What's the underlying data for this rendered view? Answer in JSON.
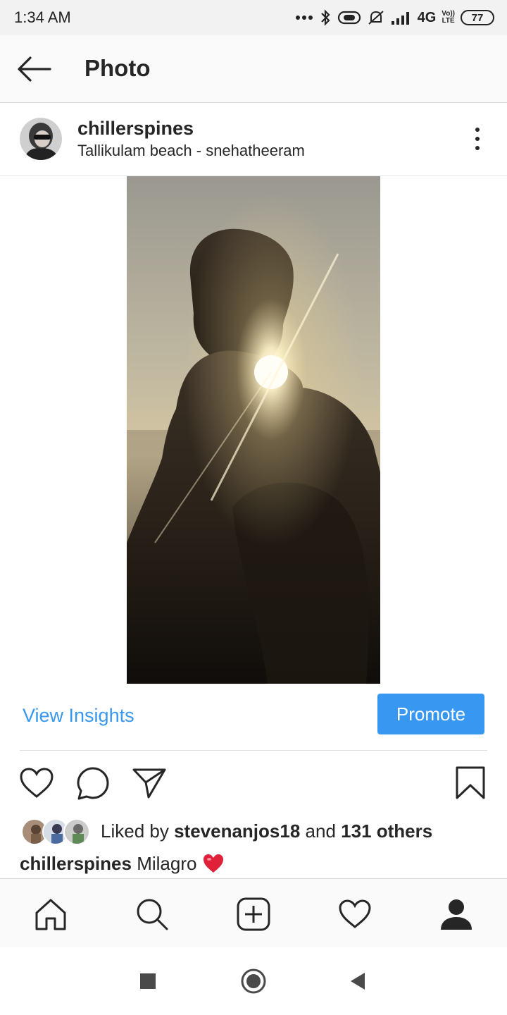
{
  "status_bar": {
    "time": "1:34 AM",
    "network": "4G",
    "volte_top": "Vo))",
    "volte_bottom": "LTE",
    "battery": "77",
    "icons": [
      "more-dots-icon",
      "bluetooth-icon",
      "toggle-icon",
      "mute-icon",
      "signal-icon"
    ]
  },
  "app_bar": {
    "title": "Photo",
    "back_icon": "back-arrow-icon"
  },
  "post": {
    "username": "chillerspines",
    "location": "Tallikulam beach - snehatheeram",
    "more_icon": "more-vertical-icon",
    "photo_description_icon": "photo-image"
  },
  "insights": {
    "view_insights_label": "View Insights",
    "promote_label": "Promote"
  },
  "actions": {
    "icons": [
      "heart-icon",
      "comment-icon",
      "share-icon",
      "bookmark-icon"
    ]
  },
  "likes": {
    "prefix": "Liked by",
    "user": "stevenanjos18",
    "joiner": "and",
    "others": "131 others"
  },
  "caption": {
    "username": "chillerspines",
    "text": "Milagro",
    "emoji": "❤️"
  },
  "bottom_nav": {
    "items": [
      "home-icon",
      "search-icon",
      "add-post-icon",
      "activity-icon",
      "profile-icon"
    ]
  },
  "system_nav": {
    "items": [
      "recents-icon",
      "home-circle-icon",
      "back-triangle-icon"
    ]
  },
  "colors": {
    "accent": "#3897f0",
    "text": "#262626",
    "divider": "#dbdbdb"
  }
}
